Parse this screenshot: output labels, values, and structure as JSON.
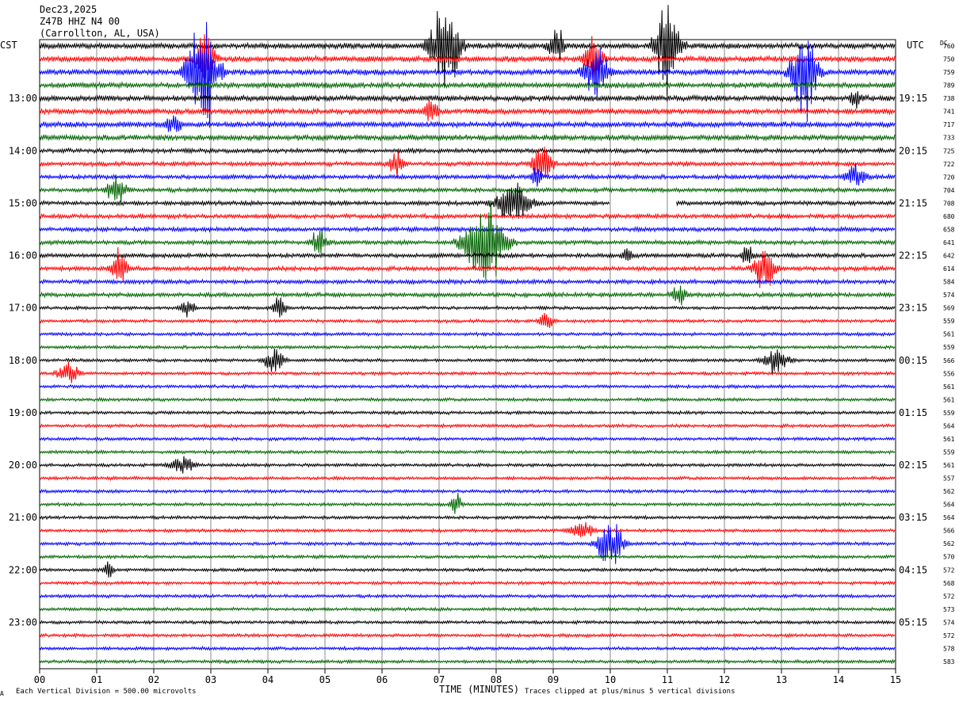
{
  "header": {
    "date": "Dec23,2025",
    "station": "Z47B HHZ N4 00",
    "location": "(Carrollton, AL, USA)",
    "left_zone": "CST",
    "right_zone": "UTC",
    "dc_label": "DC"
  },
  "footer": {
    "scale_note": "Each Vertical Division =  500.00 microvolts",
    "clip_note": "Traces clipped at plus/minus 5 vertical divisions",
    "corner_mark": "A"
  },
  "chart_data": {
    "type": "line",
    "title": "",
    "xlabel": "TIME (MINUTES)",
    "ylabel": "",
    "xlim": [
      0,
      15
    ],
    "x_ticks": [
      "00",
      "01",
      "02",
      "03",
      "04",
      "05",
      "06",
      "07",
      "08",
      "09",
      "10",
      "11",
      "12",
      "13",
      "14",
      "15"
    ],
    "grid": "vertical lines each minute",
    "trace_colors": [
      "#000000",
      "#ff0000",
      "#0000ff",
      "#006400"
    ],
    "rows_per_hour": 4,
    "row_duration_minutes": 15,
    "left_hour_labels": [
      "13:00",
      "14:00",
      "15:00",
      "16:00",
      "17:00",
      "18:00",
      "19:00",
      "20:00",
      "21:00",
      "22:00",
      "23:00"
    ],
    "right_hour_labels": [
      "19:15",
      "20:15",
      "21:15",
      "22:15",
      "23:15",
      "00:15",
      "01:15",
      "02:15",
      "03:15",
      "04:15",
      "05:15"
    ],
    "first_labeled_row": 4,
    "dc_offsets": [
      760,
      750,
      759,
      789,
      738,
      741,
      717,
      733,
      725,
      722,
      720,
      704,
      708,
      680,
      658,
      641,
      642,
      614,
      584,
      574,
      569,
      559,
      561,
      559,
      566,
      556,
      561,
      561,
      559,
      564,
      561,
      559,
      561,
      557,
      562,
      564,
      564,
      566,
      562,
      570,
      572,
      568,
      572,
      573,
      574,
      572,
      578,
      583
    ],
    "events": [
      {
        "row": 0,
        "minute": 7.1,
        "amplitude": 3.5,
        "duration_min": 0.6
      },
      {
        "row": 0,
        "minute": 9.05,
        "amplitude": 1.5,
        "duration_min": 0.3
      },
      {
        "row": 0,
        "minute": 11.0,
        "amplitude": 3.2,
        "duration_min": 0.5
      },
      {
        "row": 1,
        "minute": 2.9,
        "amplitude": 1.8,
        "duration_min": 0.4
      },
      {
        "row": 1,
        "minute": 9.7,
        "amplitude": 1.6,
        "duration_min": 0.4
      },
      {
        "row": 2,
        "minute": 2.85,
        "amplitude": 4.5,
        "duration_min": 0.6
      },
      {
        "row": 2,
        "minute": 9.75,
        "amplitude": 2.0,
        "duration_min": 0.5
      },
      {
        "row": 2,
        "minute": 13.4,
        "amplitude": 3.5,
        "duration_min": 0.5
      },
      {
        "row": 4,
        "minute": 14.3,
        "amplitude": 0.9,
        "duration_min": 0.2
      },
      {
        "row": 5,
        "minute": 6.85,
        "amplitude": 0.8,
        "duration_min": 0.3
      },
      {
        "row": 6,
        "minute": 2.35,
        "amplitude": 0.7,
        "duration_min": 0.3
      },
      {
        "row": 9,
        "minute": 6.25,
        "amplitude": 0.9,
        "duration_min": 0.3
      },
      {
        "row": 9,
        "minute": 8.8,
        "amplitude": 1.6,
        "duration_min": 0.4
      },
      {
        "row": 10,
        "minute": 8.7,
        "amplitude": 0.9,
        "duration_min": 0.2
      },
      {
        "row": 10,
        "minute": 14.3,
        "amplitude": 0.9,
        "duration_min": 0.4
      },
      {
        "row": 11,
        "minute": 1.35,
        "amplitude": 1.0,
        "duration_min": 0.4
      },
      {
        "row": 12,
        "minute": 8.3,
        "amplitude": 1.4,
        "duration_min": 0.7
      },
      {
        "row": 15,
        "minute": 7.8,
        "amplitude": 3.0,
        "duration_min": 0.8
      },
      {
        "row": 15,
        "minute": 4.9,
        "amplitude": 0.9,
        "duration_min": 0.3
      },
      {
        "row": 16,
        "minute": 12.4,
        "amplitude": 1.0,
        "duration_min": 0.2
      },
      {
        "row": 16,
        "minute": 10.3,
        "amplitude": 0.6,
        "duration_min": 0.2
      },
      {
        "row": 17,
        "minute": 1.4,
        "amplitude": 1.3,
        "duration_min": 0.3
      },
      {
        "row": 17,
        "minute": 12.7,
        "amplitude": 1.6,
        "duration_min": 0.4
      },
      {
        "row": 19,
        "minute": 11.2,
        "amplitude": 0.7,
        "duration_min": 0.3
      },
      {
        "row": 20,
        "minute": 4.2,
        "amplitude": 0.7,
        "duration_min": 0.3
      },
      {
        "row": 20,
        "minute": 2.6,
        "amplitude": 0.6,
        "duration_min": 0.3
      },
      {
        "row": 21,
        "minute": 8.9,
        "amplitude": 0.6,
        "duration_min": 0.3
      },
      {
        "row": 24,
        "minute": 4.1,
        "amplitude": 0.9,
        "duration_min": 0.4
      },
      {
        "row": 24,
        "minute": 12.9,
        "amplitude": 1.0,
        "duration_min": 0.5
      },
      {
        "row": 25,
        "minute": 0.5,
        "amplitude": 0.9,
        "duration_min": 0.4
      },
      {
        "row": 32,
        "minute": 2.5,
        "amplitude": 0.6,
        "duration_min": 0.5
      },
      {
        "row": 35,
        "minute": 7.3,
        "amplitude": 0.8,
        "duration_min": 0.2
      },
      {
        "row": 37,
        "minute": 9.5,
        "amplitude": 0.6,
        "duration_min": 0.5
      },
      {
        "row": 38,
        "minute": 10.0,
        "amplitude": 2.0,
        "duration_min": 0.5
      },
      {
        "row": 40,
        "minute": 1.2,
        "amplitude": 0.6,
        "duration_min": 0.2
      }
    ],
    "gaps": [
      {
        "row": 12,
        "start_minute": 10.0,
        "end_minute": 11.15
      }
    ]
  }
}
